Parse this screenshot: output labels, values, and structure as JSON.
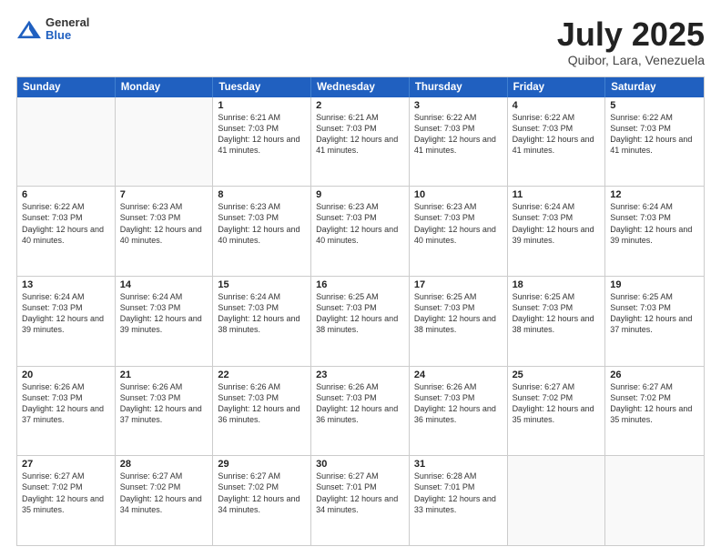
{
  "header": {
    "logo": {
      "general": "General",
      "blue": "Blue"
    },
    "title": "July 2025",
    "location": "Quibor, Lara, Venezuela"
  },
  "days_of_week": [
    "Sunday",
    "Monday",
    "Tuesday",
    "Wednesday",
    "Thursday",
    "Friday",
    "Saturday"
  ],
  "weeks": [
    [
      {
        "day": "",
        "empty": true
      },
      {
        "day": "",
        "empty": true
      },
      {
        "day": "1",
        "sunrise": "6:21 AM",
        "sunset": "7:03 PM",
        "daylight": "12 hours and 41 minutes."
      },
      {
        "day": "2",
        "sunrise": "6:21 AM",
        "sunset": "7:03 PM",
        "daylight": "12 hours and 41 minutes."
      },
      {
        "day": "3",
        "sunrise": "6:22 AM",
        "sunset": "7:03 PM",
        "daylight": "12 hours and 41 minutes."
      },
      {
        "day": "4",
        "sunrise": "6:22 AM",
        "sunset": "7:03 PM",
        "daylight": "12 hours and 41 minutes."
      },
      {
        "day": "5",
        "sunrise": "6:22 AM",
        "sunset": "7:03 PM",
        "daylight": "12 hours and 41 minutes."
      }
    ],
    [
      {
        "day": "6",
        "sunrise": "6:22 AM",
        "sunset": "7:03 PM",
        "daylight": "12 hours and 40 minutes."
      },
      {
        "day": "7",
        "sunrise": "6:23 AM",
        "sunset": "7:03 PM",
        "daylight": "12 hours and 40 minutes."
      },
      {
        "day": "8",
        "sunrise": "6:23 AM",
        "sunset": "7:03 PM",
        "daylight": "12 hours and 40 minutes."
      },
      {
        "day": "9",
        "sunrise": "6:23 AM",
        "sunset": "7:03 PM",
        "daylight": "12 hours and 40 minutes."
      },
      {
        "day": "10",
        "sunrise": "6:23 AM",
        "sunset": "7:03 PM",
        "daylight": "12 hours and 40 minutes."
      },
      {
        "day": "11",
        "sunrise": "6:24 AM",
        "sunset": "7:03 PM",
        "daylight": "12 hours and 39 minutes."
      },
      {
        "day": "12",
        "sunrise": "6:24 AM",
        "sunset": "7:03 PM",
        "daylight": "12 hours and 39 minutes."
      }
    ],
    [
      {
        "day": "13",
        "sunrise": "6:24 AM",
        "sunset": "7:03 PM",
        "daylight": "12 hours and 39 minutes."
      },
      {
        "day": "14",
        "sunrise": "6:24 AM",
        "sunset": "7:03 PM",
        "daylight": "12 hours and 39 minutes."
      },
      {
        "day": "15",
        "sunrise": "6:24 AM",
        "sunset": "7:03 PM",
        "daylight": "12 hours and 38 minutes."
      },
      {
        "day": "16",
        "sunrise": "6:25 AM",
        "sunset": "7:03 PM",
        "daylight": "12 hours and 38 minutes."
      },
      {
        "day": "17",
        "sunrise": "6:25 AM",
        "sunset": "7:03 PM",
        "daylight": "12 hours and 38 minutes."
      },
      {
        "day": "18",
        "sunrise": "6:25 AM",
        "sunset": "7:03 PM",
        "daylight": "12 hours and 38 minutes."
      },
      {
        "day": "19",
        "sunrise": "6:25 AM",
        "sunset": "7:03 PM",
        "daylight": "12 hours and 37 minutes."
      }
    ],
    [
      {
        "day": "20",
        "sunrise": "6:26 AM",
        "sunset": "7:03 PM",
        "daylight": "12 hours and 37 minutes."
      },
      {
        "day": "21",
        "sunrise": "6:26 AM",
        "sunset": "7:03 PM",
        "daylight": "12 hours and 37 minutes."
      },
      {
        "day": "22",
        "sunrise": "6:26 AM",
        "sunset": "7:03 PM",
        "daylight": "12 hours and 36 minutes."
      },
      {
        "day": "23",
        "sunrise": "6:26 AM",
        "sunset": "7:03 PM",
        "daylight": "12 hours and 36 minutes."
      },
      {
        "day": "24",
        "sunrise": "6:26 AM",
        "sunset": "7:03 PM",
        "daylight": "12 hours and 36 minutes."
      },
      {
        "day": "25",
        "sunrise": "6:27 AM",
        "sunset": "7:02 PM",
        "daylight": "12 hours and 35 minutes."
      },
      {
        "day": "26",
        "sunrise": "6:27 AM",
        "sunset": "7:02 PM",
        "daylight": "12 hours and 35 minutes."
      }
    ],
    [
      {
        "day": "27",
        "sunrise": "6:27 AM",
        "sunset": "7:02 PM",
        "daylight": "12 hours and 35 minutes."
      },
      {
        "day": "28",
        "sunrise": "6:27 AM",
        "sunset": "7:02 PM",
        "daylight": "12 hours and 34 minutes."
      },
      {
        "day": "29",
        "sunrise": "6:27 AM",
        "sunset": "7:02 PM",
        "daylight": "12 hours and 34 minutes."
      },
      {
        "day": "30",
        "sunrise": "6:27 AM",
        "sunset": "7:01 PM",
        "daylight": "12 hours and 34 minutes."
      },
      {
        "day": "31",
        "sunrise": "6:28 AM",
        "sunset": "7:01 PM",
        "daylight": "12 hours and 33 minutes."
      },
      {
        "day": "",
        "empty": true
      },
      {
        "day": "",
        "empty": true
      }
    ]
  ],
  "labels": {
    "sunrise": "Sunrise:",
    "sunset": "Sunset:",
    "daylight": "Daylight:"
  }
}
